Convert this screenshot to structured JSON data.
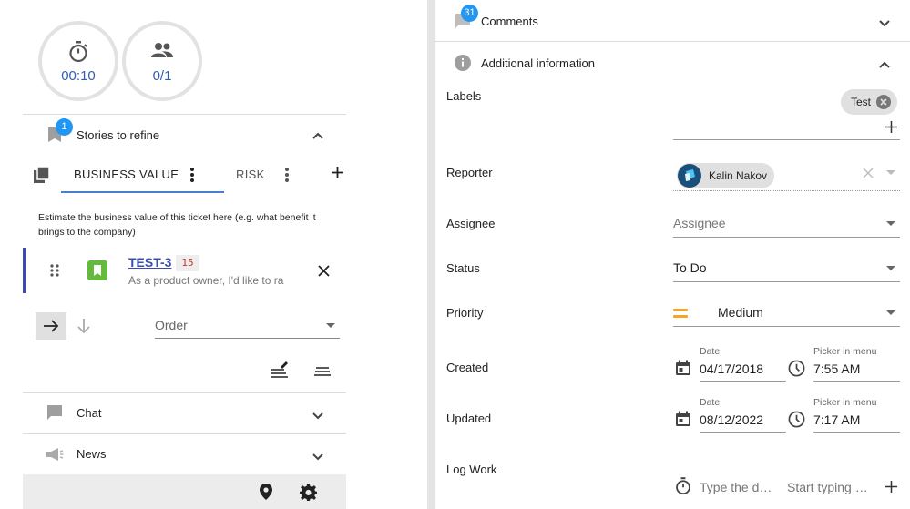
{
  "timer": {
    "value": "00:10"
  },
  "participants": {
    "value": "0/1"
  },
  "stories": {
    "badge": "1",
    "title": "Stories to refine"
  },
  "tabs": {
    "business_value": "BUSINESS VALUE",
    "risk": "RISK"
  },
  "description": "Estimate the business value of this ticket here (e.g. what benefit it brings to the company)",
  "story": {
    "key": "TEST-3",
    "points": "15",
    "summary": "As a product owner, I'd like to ra"
  },
  "order": {
    "placeholder": "Order"
  },
  "chat": {
    "title": "Chat"
  },
  "news": {
    "title": "News"
  },
  "comments": {
    "badge": "31",
    "title": "Comments"
  },
  "additional": {
    "title": "Additional information"
  },
  "labels": {
    "label": "Labels",
    "chip": "Test"
  },
  "reporter": {
    "label": "Reporter",
    "name": "Kalin Nakov"
  },
  "assignee": {
    "label": "Assignee",
    "placeholder": "Assignee"
  },
  "status": {
    "label": "Status",
    "value": "To Do"
  },
  "priority": {
    "label": "Priority",
    "value": "Medium",
    "color": "#f5a623"
  },
  "created": {
    "label": "Created",
    "date_label": "Date",
    "date": "04/17/2018",
    "time_label": "Picker in menu",
    "time": "7:55 AM"
  },
  "updated": {
    "label": "Updated",
    "date_label": "Date",
    "date": "08/12/2022",
    "time_label": "Picker in menu",
    "time": "7:17 AM"
  },
  "logwork": {
    "label": "Log Work",
    "duration_placeholder": "Type the d…",
    "comment_placeholder": "Start typing …"
  },
  "colors": {
    "accent": "#3b4bb5",
    "badge": "#2196f3",
    "link": "#2f5fb3"
  }
}
